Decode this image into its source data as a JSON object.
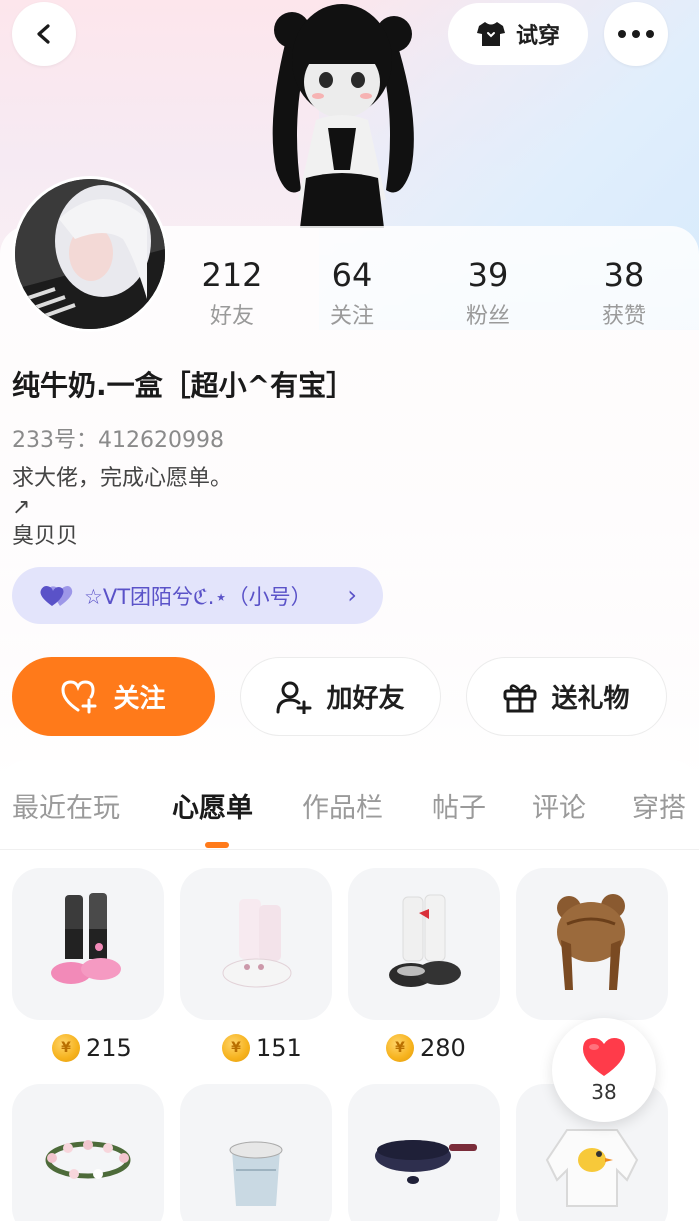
{
  "header": {
    "try_on_label": "试穿",
    "back_icon": "chevron-left-icon",
    "more_icon": "more-dots-icon"
  },
  "profile": {
    "stats": [
      {
        "value": "212",
        "label": "好友"
      },
      {
        "value": "64",
        "label": "关注"
      },
      {
        "value": "39",
        "label": "粉丝"
      },
      {
        "value": "38",
        "label": "获赞"
      }
    ],
    "nickname": "纯牛奶.一盒［超小^有宝］",
    "uid": "233号：412620998",
    "bio": "求大佬，完成心愿单。\n↗\n臭贝贝",
    "group_label": "☆VT团陌兮ℭ.⋆（小号）"
  },
  "actions": {
    "follow_label": "关注",
    "add_friend_label": "加好友",
    "gift_label": "送礼物"
  },
  "tabs": [
    {
      "label": "最近在玩"
    },
    {
      "label": "心愿单"
    },
    {
      "label": "作品栏"
    },
    {
      "label": "帖子"
    },
    {
      "label": "评论"
    },
    {
      "label": "穿搭"
    }
  ],
  "active_tab": "心愿单",
  "wishlist": {
    "prices": [
      "215",
      "151",
      "280"
    ]
  },
  "like_bubble": {
    "count": "38"
  },
  "colors": {
    "accent": "#ff7a1a",
    "group_pill_bg": "#e3e4fb",
    "group_text": "#5a52c8",
    "heart": "#ff3b4a"
  }
}
